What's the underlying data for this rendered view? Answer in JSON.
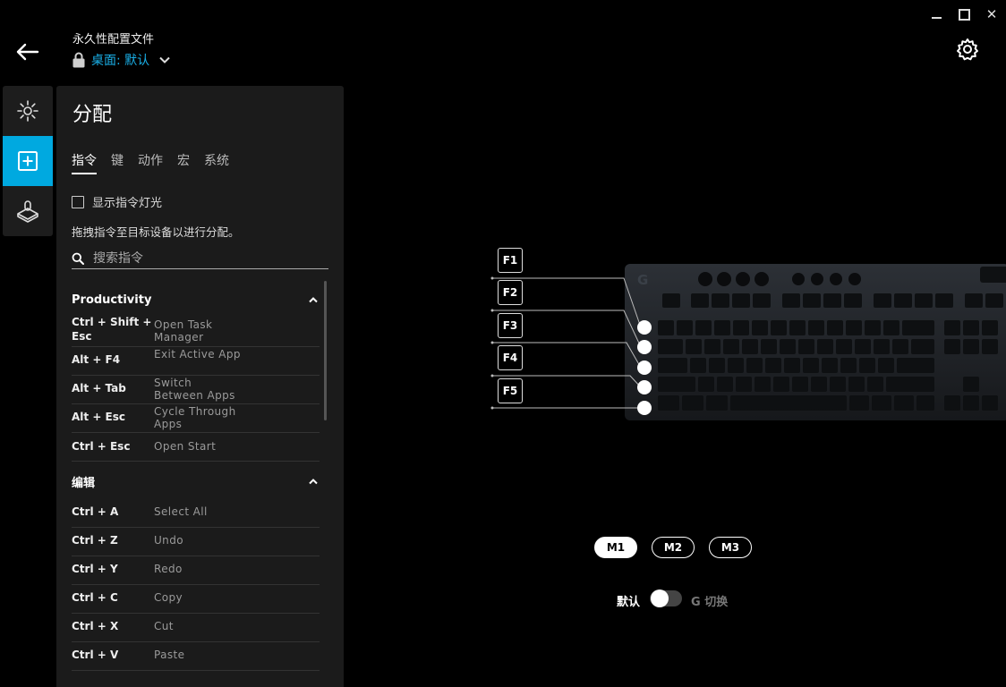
{
  "window": {
    "close_glyph": "✕"
  },
  "header": {
    "caption": "永久性配置文件",
    "profile_name": "桌面: 默认"
  },
  "nav": {
    "items": [
      {
        "icon": "lighting-icon",
        "active": false
      },
      {
        "icon": "assignments-icon",
        "active": true
      },
      {
        "icon": "game-mode-icon",
        "active": false
      }
    ]
  },
  "panel": {
    "title": "分配",
    "tabs": [
      "指令",
      "键",
      "动作",
      "宏",
      "系统"
    ],
    "checkbox_label": "显示指令灯光",
    "hint": "拖拽指令至目标设备以进行分配。",
    "search_placeholder": "搜索指令",
    "sections": [
      {
        "title": "Productivity",
        "commands": [
          {
            "keys": "Ctrl + Shift + Esc",
            "desc": "Open Task Manager"
          },
          {
            "keys": "Alt + F4",
            "desc": "Exit Active App"
          },
          {
            "keys": "Alt + Tab",
            "desc": "Switch Between Apps"
          },
          {
            "keys": "Alt + Esc",
            "desc": "Cycle Through Apps"
          },
          {
            "keys": "Ctrl + Esc",
            "desc": "Open Start"
          }
        ]
      },
      {
        "title": "编辑",
        "commands": [
          {
            "keys": "Ctrl + A",
            "desc": "Select All"
          },
          {
            "keys": "Ctrl + Z",
            "desc": "Undo"
          },
          {
            "keys": "Ctrl + Y",
            "desc": "Redo"
          },
          {
            "keys": "Ctrl + C",
            "desc": "Copy"
          },
          {
            "keys": "Ctrl + X",
            "desc": "Cut"
          },
          {
            "keys": "Ctrl + V",
            "desc": "Paste"
          }
        ]
      }
    ]
  },
  "device": {
    "gkeys": [
      "F1",
      "F2",
      "F3",
      "F4",
      "F5"
    ],
    "memory_modes": [
      "M1",
      "M2",
      "M3"
    ],
    "active_mode": "M1",
    "toggle_left": "默认",
    "toggle_right": "G 切换"
  },
  "colors": {
    "accent": "#00a9e0",
    "profile_text": "#1ab0e8"
  }
}
